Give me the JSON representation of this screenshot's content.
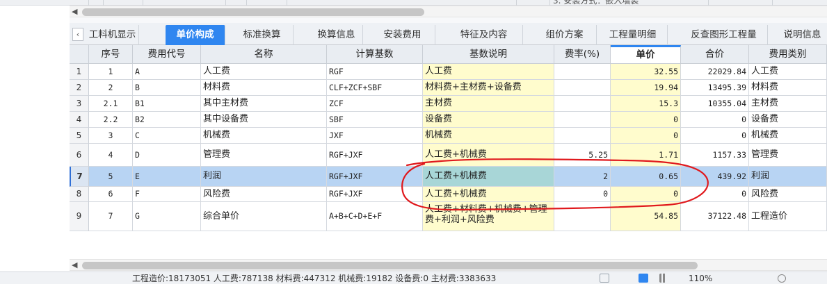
{
  "top": {
    "cut_text": "3. 安装方式：嵌入墙装"
  },
  "tabs": [
    {
      "label": "工料机显示",
      "active": false
    },
    {
      "label": "单价构成",
      "active": true
    },
    {
      "label": "标准换算",
      "active": false
    },
    {
      "label": "换算信息",
      "active": false
    },
    {
      "label": "安装费用",
      "active": false
    },
    {
      "label": "特征及内容",
      "active": false
    },
    {
      "label": "组价方案",
      "active": false
    },
    {
      "label": "工程量明细",
      "active": false
    },
    {
      "label": "反查图形工程量",
      "active": false
    },
    {
      "label": "说明信息",
      "active": false
    }
  ],
  "table": {
    "headers": [
      "序号",
      "费用代号",
      "名称",
      "计算基数",
      "基数说明",
      "费率(%)",
      "单价",
      "合价",
      "费用类别"
    ],
    "rows": [
      {
        "rn": "1",
        "seq": "1",
        "code": "A",
        "name": "人工费",
        "base": "RGF",
        "desc": "人工费",
        "rate": "",
        "unit": "32.55",
        "total": "22029.84",
        "category": "人工费"
      },
      {
        "rn": "2",
        "seq": "2",
        "code": "B",
        "name": "材料费",
        "base": "CLF+ZCF+SBF",
        "desc": "材料费+主材费+设备费",
        "rate": "",
        "unit": "19.94",
        "total": "13495.39",
        "category": "材料费"
      },
      {
        "rn": "3",
        "seq": "2.1",
        "code": "B1",
        "name": "其中主材费",
        "base": "ZCF",
        "desc": "主材费",
        "rate": "",
        "unit": "15.3",
        "total": "10355.04",
        "category": "主材费"
      },
      {
        "rn": "4",
        "seq": "2.2",
        "code": "B2",
        "name": "其中设备费",
        "base": "SBF",
        "desc": "设备费",
        "rate": "",
        "unit": "0",
        "total": "0",
        "category": "设备费"
      },
      {
        "rn": "5",
        "seq": "3",
        "code": "C",
        "name": "机械费",
        "base": "JXF",
        "desc": "机械费",
        "rate": "",
        "unit": "0",
        "total": "0",
        "category": "机械费"
      },
      {
        "rn": "6",
        "seq": "4",
        "code": "D",
        "name": "管理费",
        "base": "RGF+JXF",
        "desc": "人工费+机械费",
        "rate": "5.25",
        "unit": "1.71",
        "total": "1157.33",
        "category": "管理费"
      },
      {
        "rn": "7",
        "seq": "5",
        "code": "E",
        "name": "利润",
        "base": "RGF+JXF",
        "desc": "人工费+机械费",
        "rate": "2",
        "unit": "0.65",
        "total": "439.92",
        "category": "利润"
      },
      {
        "rn": "8",
        "seq": "6",
        "code": "F",
        "name": "风险费",
        "base": "RGF+JXF",
        "desc": "人工费+机械费",
        "rate": "0",
        "unit": "0",
        "total": "0",
        "category": "风险费"
      },
      {
        "rn": "9",
        "seq": "7",
        "code": "G",
        "name": "综合单价",
        "base": "A+B+C+D+E+F",
        "desc": "人工费+材料费+机械费+管理费+利润+风险费",
        "rate": "",
        "unit": "54.85",
        "total": "37122.48",
        "category": "工程造价"
      }
    ]
  },
  "status": {
    "text": "工程造价:18173051  人工费:787138  材料费:447312  机械费:19182  设备费:0  主材费:3383633",
    "zoom": "110%"
  },
  "colors": {
    "accent": "#2f86f0",
    "yellow_cell": "#fffccd",
    "selected_row": "#b8d4f3",
    "annotation": "#e0191d"
  }
}
